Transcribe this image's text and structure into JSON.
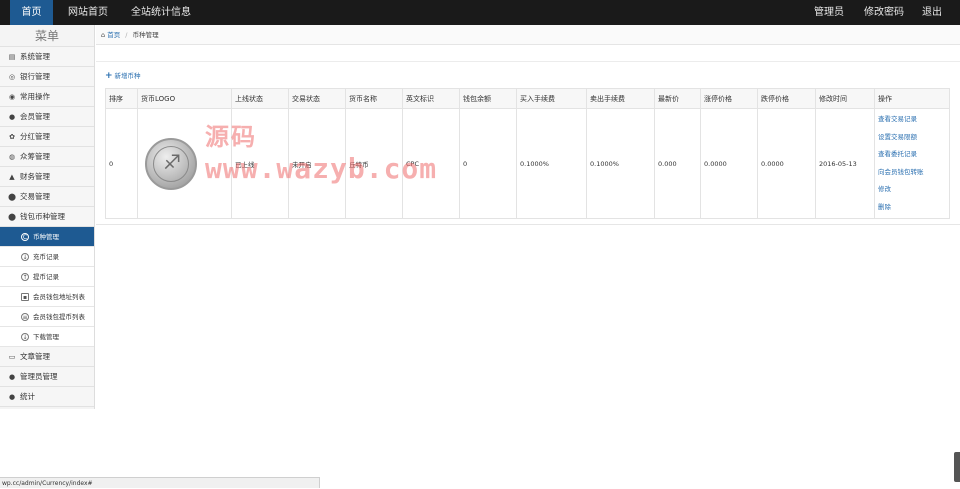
{
  "topnav": {
    "items": [
      "首页",
      "网站首页",
      "全站统计信息"
    ],
    "right_items": [
      "管理员",
      "修改密码",
      "退出"
    ]
  },
  "sidebar": {
    "title": "菜单",
    "items": [
      {
        "label": "系统管理",
        "icon": "gauge-icon"
      },
      {
        "label": "银行管理",
        "icon": "bank-icon"
      },
      {
        "label": "常用操作",
        "icon": "settings-icon"
      },
      {
        "label": "会员管理",
        "icon": "user-icon"
      },
      {
        "label": "分红管理",
        "icon": "gear-icon"
      },
      {
        "label": "众筹管理",
        "icon": "group-icon"
      },
      {
        "label": "财务管理",
        "icon": "money-icon"
      },
      {
        "label": "交易管理",
        "icon": "exchange-icon"
      },
      {
        "label": "钱包币种管理",
        "icon": "wallet-icon"
      }
    ],
    "sub_items": [
      {
        "label": "币种管理",
        "icon": "coin-icon"
      },
      {
        "label": "充币记录",
        "icon": "deposit-icon"
      },
      {
        "label": "提币记录",
        "icon": "withdraw-icon"
      },
      {
        "label": "会员钱包地址列表",
        "icon": "address-icon"
      },
      {
        "label": "会员钱包提币列表",
        "icon": "list-icon"
      },
      {
        "label": "下载管理",
        "icon": "download-icon"
      }
    ],
    "bottom_items": [
      {
        "label": "文章管理",
        "icon": "document-icon"
      },
      {
        "label": "管理员管理",
        "icon": "admin-icon"
      },
      {
        "label": "统计",
        "icon": "stats-icon"
      }
    ]
  },
  "breadcrumb": {
    "home": "首页",
    "current": "币种管理"
  },
  "actions": {
    "add_label": "新增币种"
  },
  "table": {
    "columns": [
      "排序",
      "货币LOGO",
      "上线状态",
      "交易状态",
      "货币名称",
      "英文标识",
      "钱包余额",
      "买入手续费",
      "卖出手续费",
      "最新价",
      "涨停价格",
      "跌停价格",
      "修改时间",
      "操作"
    ],
    "row": {
      "sort": "0",
      "online_status": "已上线",
      "trade_status": "未开启",
      "name": "丘特币",
      "symbol": "CPC",
      "balance": "0",
      "buy_fee": "0.1000%",
      "sell_fee": "0.1000%",
      "latest_price": "0.000",
      "limit_up": "0.0000",
      "limit_down": "0.0000",
      "modified": "2016-05-13"
    },
    "operations": [
      "查看交易记录",
      "设置交易限额",
      "查看委托记录",
      "向会员钱包转账",
      "修改",
      "删除"
    ]
  },
  "watermark": {
    "line1": "源码",
    "line2": "www.wazyb.com"
  },
  "status_url": "wp.cc/admin/Currency/index#"
}
